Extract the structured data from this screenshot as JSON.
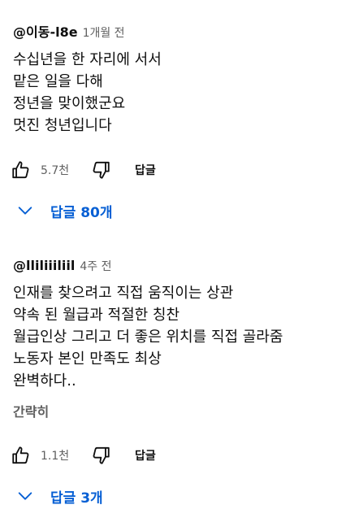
{
  "comments": [
    {
      "author": "@이동-l8e",
      "time": "1개월 전",
      "lines": [
        "수십년을 한 자리에 서서",
        "맡은 일을 다해",
        "정년을 맞이했군요",
        "멋진 청년입니다"
      ],
      "likes": "5.7천",
      "reply_label": "답글",
      "replies_label": "답글 80개"
    },
    {
      "author": "@lliliiiliil",
      "time": "4주 전",
      "lines": [
        "인재를 찾으려고 직접 움직이는 상관",
        "약속 된 월급과 적절한 칭찬",
        "월급인상 그리고 더 좋은 위치를 직접 골라줌",
        "노동자 본인 만족도 최상",
        "완벽하다.."
      ],
      "show_less": "간략히",
      "likes": "1.1천",
      "reply_label": "답글",
      "replies_label": "답글 3개"
    }
  ],
  "icons": {
    "like": "thumbs-up-icon",
    "dislike": "thumbs-down-icon",
    "expand": "chevron-down-icon"
  },
  "colors": {
    "text": "#0f0f0f",
    "secondary": "#606060",
    "link": "#065fd4"
  }
}
